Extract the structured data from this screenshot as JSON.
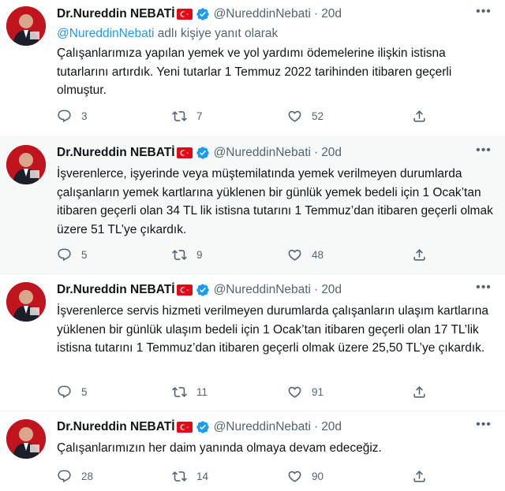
{
  "tweets": [
    {
      "name": "Dr.Nureddin NEBATİ",
      "handle": "@NureddinNebati",
      "time": "20d",
      "reply_to_mention": "@NureddinNebati",
      "reply_to_suffix": " adlı kişiye yanıt olarak",
      "text": "Çalışanlarımıza yapılan yemek ve yol yardımı ödemelerine ilişkin istisna tutarlarını artırdık. Yeni tutarlar 1 Temmuz 2022 tarihinden itibaren geçerli olmuştur.",
      "replies": "3",
      "retweets": "7",
      "likes": "52"
    },
    {
      "name": "Dr.Nureddin NEBATİ",
      "handle": "@NureddinNebati",
      "time": "20d",
      "text": "İşverenlerce, işyerinde veya müştemilatında yemek verilmeyen durumlarda çalışanların yemek kartlarına yüklenen bir günlük yemek bedeli için 1 Ocak’tan itibaren geçerli olan 34 TL lik istisna tutarını 1 Temmuz’dan itibaren geçerli olmak üzere 51 TL’ye çıkardık.",
      "replies": "5",
      "retweets": "9",
      "likes": "48"
    },
    {
      "name": "Dr.Nureddin NEBATİ",
      "handle": "@NureddinNebati",
      "time": "20d",
      "text": "İşverenlerce servis hizmeti verilmeyen durumlarda çalışanların ulaşım kartlarına yüklenen bir günlük ulaşım bedeli için 1 Ocak’tan itibaren geçerli olan 17 TL’lik istisna tutarını 1 Temmuz’dan itibaren geçerli olmak üzere 25,50 TL’ye çıkardık.",
      "replies": "5",
      "retweets": "11",
      "likes": "91"
    },
    {
      "name": "Dr.Nureddin NEBATİ",
      "handle": "@NureddinNebati",
      "time": "20d",
      "text": "Çalışanlarımızın her daim yanında olmaya devam edeceğiz.",
      "replies": "28",
      "retweets": "14",
      "likes": "90"
    }
  ],
  "icons": {
    "more": "more-horizontal-icon",
    "reply": "reply-icon",
    "retweet": "retweet-icon",
    "like": "like-icon",
    "share": "share-icon",
    "verified": "verified-badge-icon",
    "flag": "turkey-flag-icon"
  },
  "colors": {
    "accent": "#1d9bf0",
    "secondary_text": "#536471",
    "flag_red": "#e30a17"
  }
}
